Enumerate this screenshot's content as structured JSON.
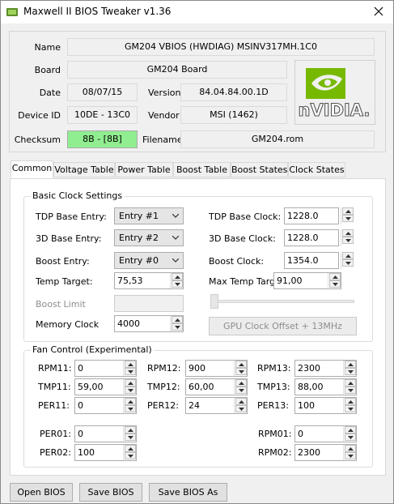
{
  "window": {
    "title": "Maxwell II BIOS Tweaker v1.36",
    "close_glyph": "✕"
  },
  "info": {
    "name_label": "Name",
    "name_value": "GM204 VBIOS (HWDIAG) MSINV317MH.1C0",
    "board_label": "Board",
    "board_value": "GM204 Board",
    "date_label": "Date",
    "date_value": "08/07/15",
    "version_label": "Version",
    "version_value": "84.04.84.00.1D",
    "device_id_label": "Device ID",
    "device_id_value": "10DE - 13C0",
    "vendor_label": "Vendor",
    "vendor_value": "MSI (1462)",
    "checksum_label": "Checksum",
    "checksum_value": "8B - [8B]",
    "filename_label": "Filename",
    "filename_value": "GM204.rom",
    "logo_text": "nVIDIA."
  },
  "tabs": [
    "Common",
    "Voltage Table",
    "Power Table",
    "Boost Table",
    "Boost States",
    "Clock States"
  ],
  "basic_clock": {
    "title": "Basic Clock Settings",
    "tdp_base_entry_label": "TDP Base Entry:",
    "tdp_base_entry_value": "Entry #1",
    "base3d_entry_label": "3D Base Entry:",
    "base3d_entry_value": "Entry #2",
    "boost_entry_label": "Boost Entry:",
    "boost_entry_value": "Entry #0",
    "temp_target_label": "Temp Target:",
    "temp_target_value": "75,53",
    "boost_limit_label": "Boost Limit",
    "boost_limit_value": "",
    "memory_clock_label": "Memory Clock",
    "memory_clock_value": "4000",
    "tdp_base_clock_label": "TDP Base Clock:",
    "tdp_base_clock_value": "1228.0",
    "base3d_clock_label": "3D Base Clock:",
    "base3d_clock_value": "1228.0",
    "boost_clock_label": "Boost Clock:",
    "boost_clock_value": "1354.0",
    "max_temp_target_label": "Max Temp Target:",
    "max_temp_target_value": "91,00",
    "gpu_offset_button": "GPU Clock Offset + 13MHz"
  },
  "fan_control": {
    "title": "Fan Control (Experimental)",
    "rpm11_label": "RPM11:",
    "rpm11_value": "0",
    "rpm12_label": "RPM12:",
    "rpm12_value": "900",
    "rpm13_label": "RPM13:",
    "rpm13_value": "2300",
    "tmp11_label": "TMP11:",
    "tmp11_value": "59,00",
    "tmp12_label": "TMP12:",
    "tmp12_value": "60,00",
    "tmp13_label": "TMP13:",
    "tmp13_value": "88,00",
    "per11_label": "PER11:",
    "per11_value": "0",
    "per12_label": "PER12:",
    "per12_value": "24",
    "per13_label": "PER13:",
    "per13_value": "100",
    "per01_label": "PER01:",
    "per01_value": "0",
    "per02_label": "PER02:",
    "per02_value": "100",
    "rpm01_label": "RPM01:",
    "rpm01_value": "0",
    "rpm02_label": "RPM02:",
    "rpm02_value": "2300"
  },
  "buttons": {
    "open": "Open BIOS",
    "save": "Save BIOS",
    "save_as": "Save BIOS As"
  },
  "colors": {
    "checksum_ok": "#90ee90",
    "nvidia_green": "#76b900"
  }
}
